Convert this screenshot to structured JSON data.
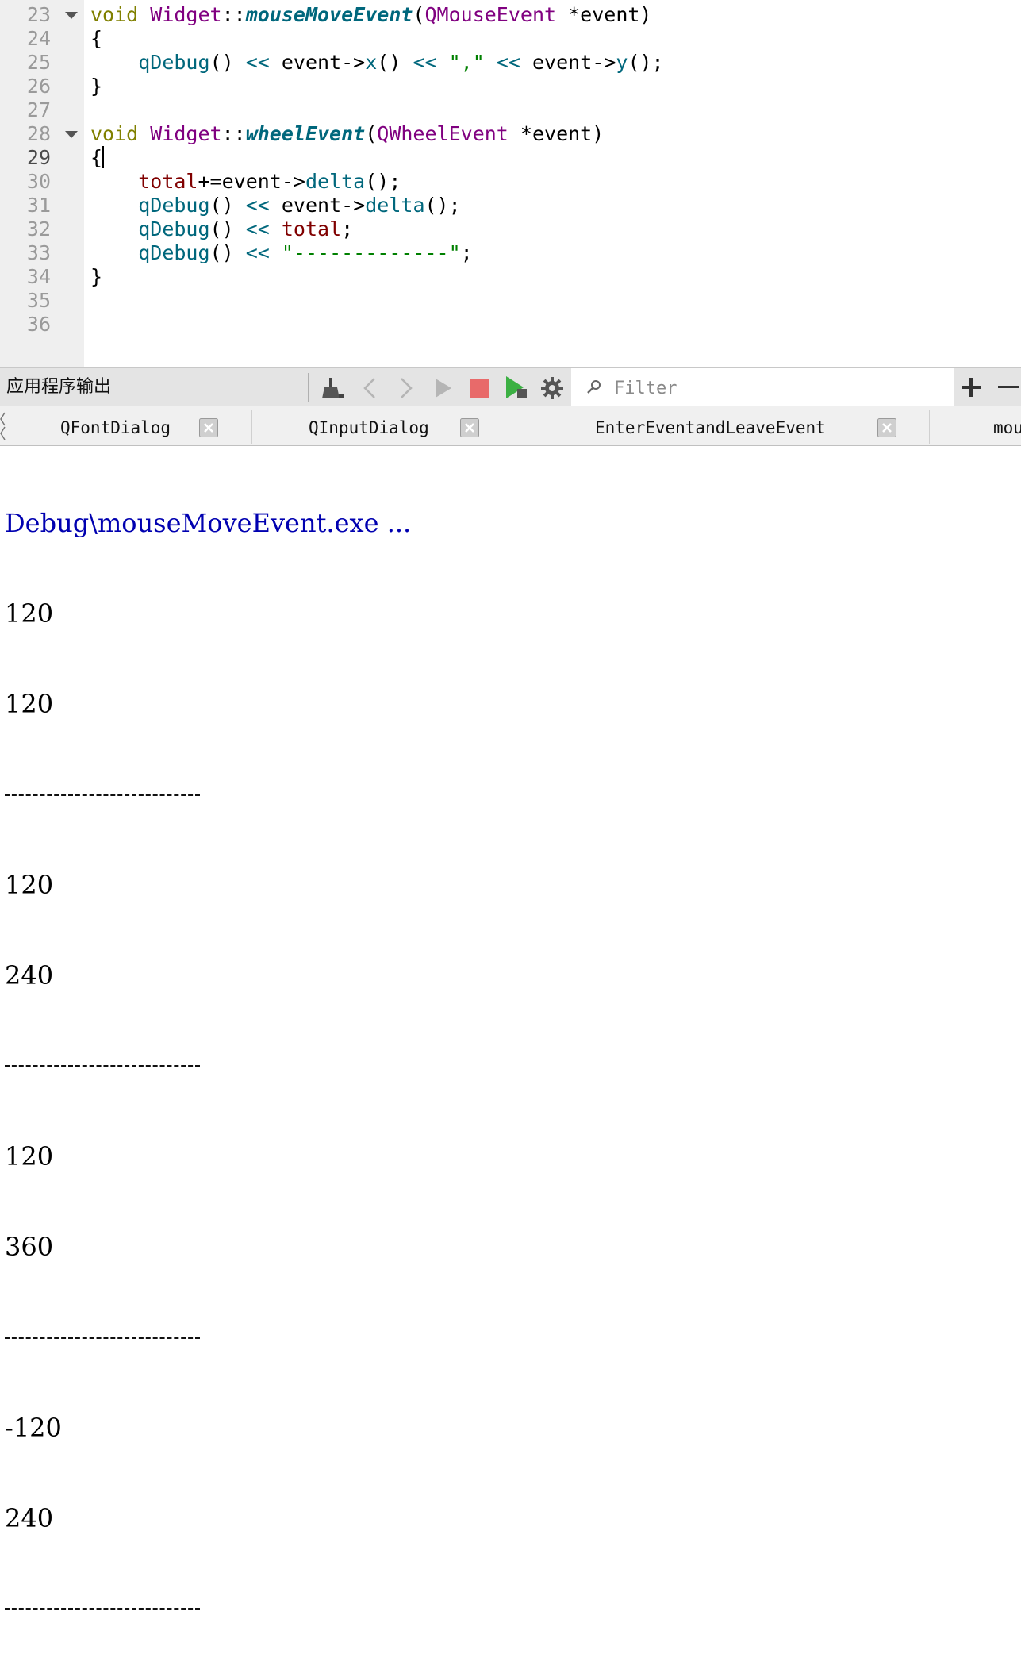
{
  "editor": {
    "current_line": "29",
    "lines": [
      {
        "num": "23",
        "fold": true
      },
      {
        "num": "24"
      },
      {
        "num": "25"
      },
      {
        "num": "26"
      },
      {
        "num": "27"
      },
      {
        "num": "28",
        "fold": true
      },
      {
        "num": "29"
      },
      {
        "num": "30"
      },
      {
        "num": "31"
      },
      {
        "num": "32"
      },
      {
        "num": "33"
      },
      {
        "num": "34"
      },
      {
        "num": "35"
      },
      {
        "num": "36"
      }
    ],
    "code": {
      "l23": {
        "kw": "void",
        "cls": "Widget",
        "sep": "::",
        "fn": "mouseMoveEvent",
        "p1": "(",
        "type": "QMouseEvent",
        "rest": " *event)"
      },
      "l24": "{",
      "l25": {
        "qd": "qDebug",
        "par": "()",
        "op1": " << ",
        "ev1": "event",
        "arrow1": "->",
        "m1": "x",
        "par2": "()",
        "op2": " << ",
        "str": "\",\"",
        "op3": " << ",
        "ev2": "event",
        "arrow2": "->",
        "m2": "y",
        "end": "();"
      },
      "l26": "}",
      "l28": {
        "kw": "void",
        "cls": "Widget",
        "sep": "::",
        "fn": "wheelEvent",
        "p1": "(",
        "type": "QWheelEvent",
        "rest": " *event)"
      },
      "l29": "{",
      "l30": {
        "var": "total",
        "op": "+=",
        "ev": "event",
        "arrow": "->",
        "m": "delta",
        "end": "();"
      },
      "l31": {
        "qd": "qDebug",
        "par": "()",
        "op": " << ",
        "ev": "event",
        "arrow": "->",
        "m": "delta",
        "end": "();"
      },
      "l32": {
        "qd": "qDebug",
        "par": "()",
        "op": " << ",
        "var": "total",
        "end": ";"
      },
      "l33": {
        "qd": "qDebug",
        "par": "()",
        "op": " << ",
        "str": "\"-------------\"",
        "end": ";"
      },
      "l34": "}"
    }
  },
  "pane": {
    "title": "应用程序输出",
    "filter_placeholder": "Filter",
    "toolbar_icons": [
      "clean-broom-icon",
      "chevron-left-icon",
      "chevron-right-icon",
      "run-icon",
      "stop-icon",
      "debug-run-icon",
      "gear-icon"
    ],
    "add_label": "+",
    "remove_label": "—"
  },
  "tabs": [
    {
      "label": "QFontDialog"
    },
    {
      "label": "QInputDialog"
    },
    {
      "label": "EnterEventandLeaveEvent"
    },
    {
      "label": "mou"
    }
  ],
  "output": {
    "header": "Debug\\mouseMoveEvent.exe ...",
    "separator": "-------------",
    "lines": [
      "120",
      "120",
      "-------------",
      "120",
      "240",
      "-------------",
      "120",
      "360",
      "-------------",
      "-120",
      "240",
      "-------------"
    ]
  },
  "colors": {
    "keyword": "#808000",
    "type": "#800080",
    "function": "#00677c",
    "variable": "#800000",
    "string": "#008000",
    "output_header": "#0000b0",
    "stop": "#e05a5a",
    "run": "#3cb043"
  }
}
